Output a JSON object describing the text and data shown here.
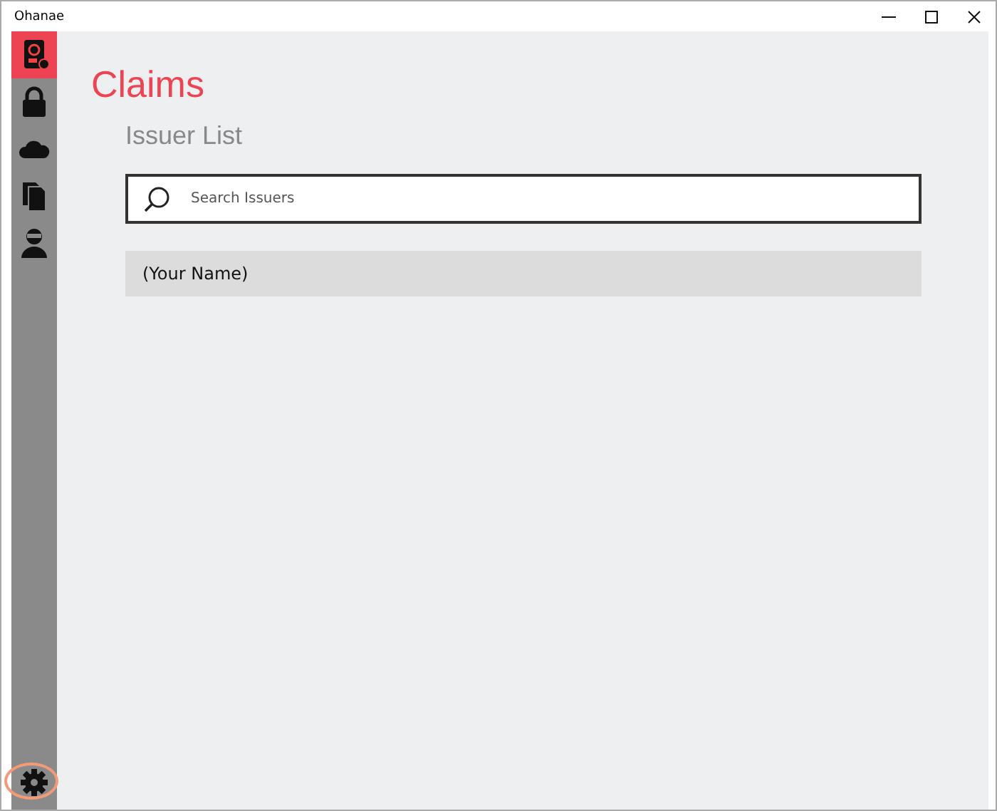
{
  "window": {
    "title": "Ohanae"
  },
  "sidebar": {
    "items": [
      {
        "kind": "badge",
        "selected": true
      },
      {
        "kind": "lock",
        "selected": false
      },
      {
        "kind": "cloud",
        "selected": false
      },
      {
        "kind": "documents",
        "selected": false
      },
      {
        "kind": "person",
        "selected": false
      }
    ],
    "settings": {
      "highlighted": true
    }
  },
  "page": {
    "title": "Claims",
    "subtitle": "Issuer List"
  },
  "search": {
    "placeholder": "Search Issuers"
  },
  "issuers": [
    {
      "name": "(Your Name)"
    }
  ]
}
